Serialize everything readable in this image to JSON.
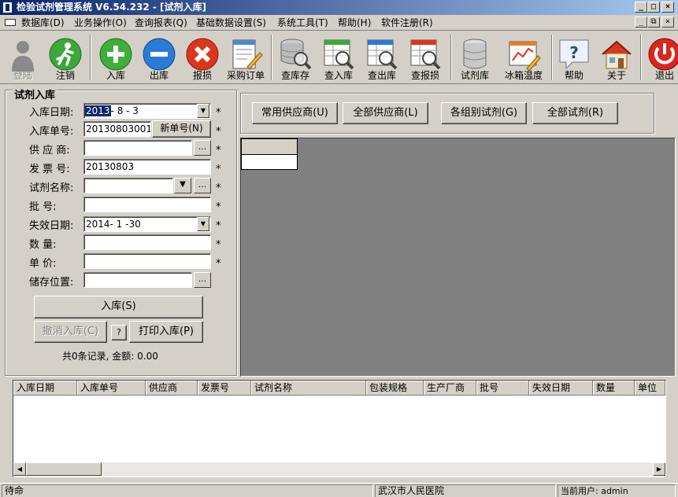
{
  "window": {
    "title": "检验试剂管理系统 V6.54.232 - [试剂入库]",
    "min_glyph": "_",
    "max_glyph": "□",
    "close_glyph": "×",
    "restore_glyph": "⧉"
  },
  "menu": [
    "数据库(D)",
    "业务操作(O)",
    "查询报表(Q)",
    "基础数据设置(S)",
    "系统工具(T)",
    "帮助(H)",
    "软件注册(R)"
  ],
  "toolbar": [
    {
      "label": "登陆",
      "icon": "user-silhouette-icon",
      "disabled": true
    },
    {
      "label": "注销",
      "icon": "running-man-icon",
      "disabled": false
    },
    {
      "label": "入库",
      "icon": "plus-circle-icon",
      "disabled": false
    },
    {
      "label": "出库",
      "icon": "minus-circle-icon",
      "disabled": false
    },
    {
      "label": "报损",
      "icon": "x-circle-icon",
      "disabled": false
    },
    {
      "label": "采购订单",
      "icon": "document-pencil-icon",
      "disabled": false
    },
    {
      "label": "查库存",
      "icon": "database-search-icon",
      "disabled": false
    },
    {
      "label": "查入库",
      "icon": "table-search-green-icon",
      "disabled": false
    },
    {
      "label": "查出库",
      "icon": "table-search-blue-icon",
      "disabled": false
    },
    {
      "label": "查报损",
      "icon": "table-search-red-icon",
      "disabled": false
    },
    {
      "label": "试剂库",
      "icon": "database-icon",
      "disabled": false
    },
    {
      "label": "冰箱温度",
      "icon": "chart-pencil-icon",
      "disabled": false
    },
    {
      "label": "帮助",
      "icon": "help-icon",
      "disabled": false
    },
    {
      "label": "关于",
      "icon": "house-icon",
      "disabled": false
    },
    {
      "label": "退出",
      "icon": "power-icon",
      "disabled": false
    }
  ],
  "form": {
    "group_title": "试剂入库",
    "labels": [
      "入库日期:",
      "入库单号:",
      "供 应 商:",
      "发 票 号:",
      "试剂名称:",
      "批    号:",
      "失效日期:",
      "数    量:",
      "单    价:",
      "储存位置:"
    ],
    "date_selected": "2013",
    "date_rest": "- 8 - 3",
    "order_no": "20130803001",
    "new_order_btn": "新单号(N)",
    "supplier": "",
    "invoice_no": "20130803",
    "reagent_name": "",
    "batch_no": "",
    "expiry_date": "2014- 1 -30",
    "quantity": "",
    "unit_price": "",
    "storage": "",
    "ellipsis": "...",
    "dropdown_glyph": "▼",
    "help_glyph": "?",
    "required_mark": "*",
    "in_btn": "入库(S)",
    "cancel_btn": "撤消入库(C)",
    "print_btn": "打印入库(P)",
    "summary": "共0条记录, 金额: 0.00"
  },
  "filters": [
    "常用供应商(U)",
    "全部供应商(L)",
    "各组别试剂(G)",
    "全部试剂(R)"
  ],
  "table": {
    "columns": [
      "入库日期",
      "入库单号",
      "供应商",
      "发票号",
      "试剂名称",
      "包装规格",
      "生产厂商",
      "批号",
      "失效日期",
      "数量",
      "单位"
    ],
    "rows": []
  },
  "status": {
    "state": "待命",
    "hospital": "武汉市人民医院",
    "user": "当前用户: admin"
  }
}
